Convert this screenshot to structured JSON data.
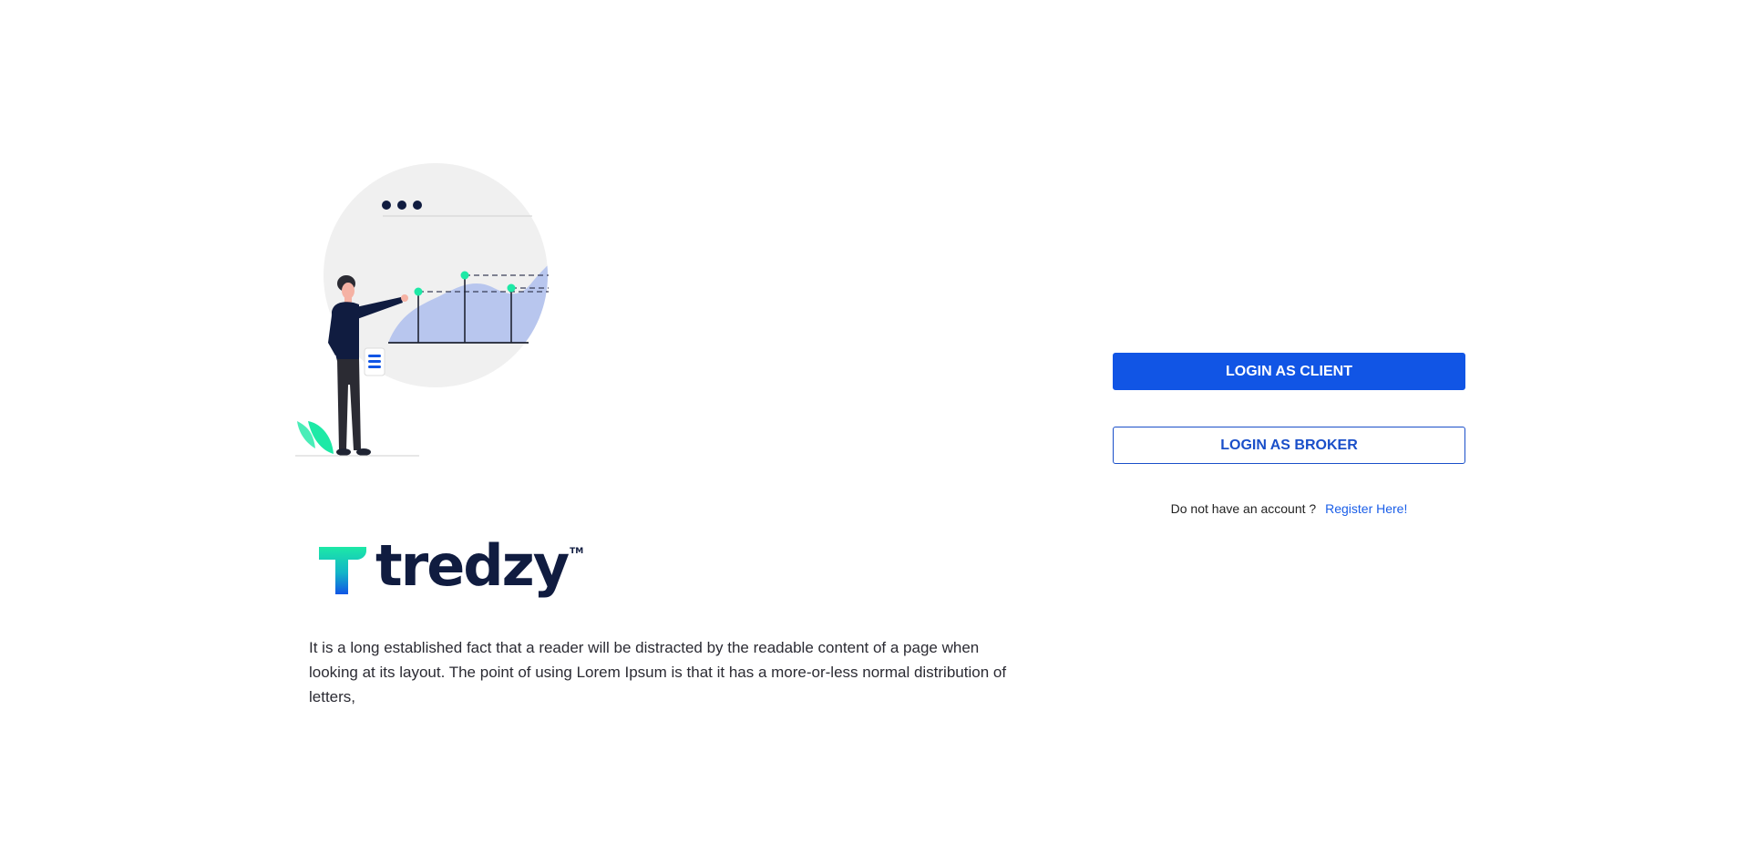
{
  "brand": {
    "name": "tredzy",
    "trademark": "TM",
    "colors": {
      "primary": "#1155e5",
      "navy": "#101c40",
      "mint": "#1de9a6",
      "chart_fill": "#b8c6ee"
    }
  },
  "intro": {
    "description": "It is a long established fact that a reader will be distracted by the readable content of a page when looking at its layout. The point of using Lorem Ipsum is that it has a more-or-less normal distribution of letters,"
  },
  "auth": {
    "login_client_label": "LOGIN AS CLIENT",
    "login_broker_label": "LOGIN AS BROKER",
    "register_prompt": "Do not have an account ?",
    "register_link": "Register Here!"
  },
  "illustration": {
    "subject": "person-presenting-chart"
  }
}
